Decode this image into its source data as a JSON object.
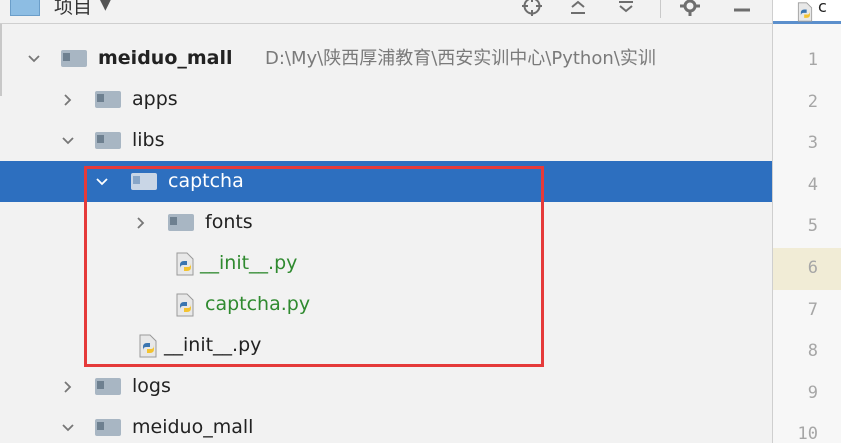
{
  "toolbar": {
    "title": "项目",
    "tools": [
      "locate-icon",
      "collapse-all-icon",
      "expand-all-icon",
      "gear-icon",
      "hide-icon"
    ]
  },
  "tree": {
    "root": {
      "name": "meiduo_mall",
      "path": "D:\\My\\陕西厚浦教育\\西安实训中心\\Python\\实训"
    },
    "apps": "apps",
    "libs": "libs",
    "captcha": "captcha",
    "fonts": "fonts",
    "captcha_init": "__init__.py",
    "captcha_py": "captcha.py",
    "libs_init": "__init__.py",
    "logs": "logs",
    "meiduo_mall_pkg": "meiduo_mall"
  },
  "editor": {
    "tab_label": "c",
    "line_numbers": [
      "1",
      "2",
      "3",
      "4",
      "5",
      "6",
      "7",
      "8",
      "9",
      "10"
    ],
    "current_line": "6"
  },
  "colors": {
    "selection": "#2d6fbf",
    "highlight_box": "#e53a3a",
    "python_file_text": "#2f8a2f",
    "current_line": "#f1ecd6"
  }
}
